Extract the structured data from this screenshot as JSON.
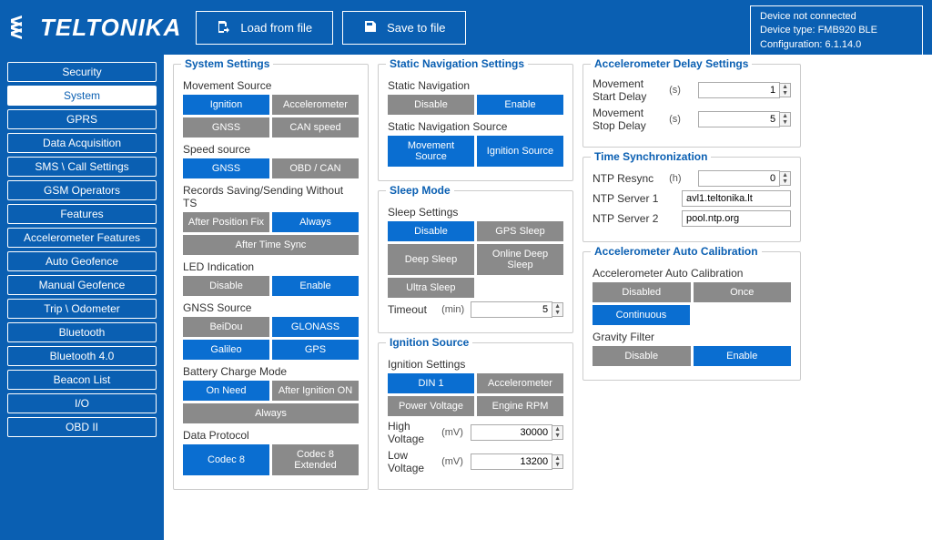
{
  "header": {
    "logo_text": "TELTONIKA",
    "load_label": "Load from file",
    "save_label": "Save to file",
    "device_line1": "Device not connected",
    "device_line2": "Device type: FMB920 BLE",
    "device_line3": "Configuration: 6.1.14.0"
  },
  "sidebar": {
    "items": [
      {
        "label": "Security",
        "active": false
      },
      {
        "label": "System",
        "active": true
      },
      {
        "label": "GPRS",
        "active": false
      },
      {
        "label": "Data Acquisition",
        "active": false
      },
      {
        "label": "SMS \\ Call Settings",
        "active": false
      },
      {
        "label": "GSM Operators",
        "active": false
      },
      {
        "label": "Features",
        "active": false
      },
      {
        "label": "Accelerometer Features",
        "active": false
      },
      {
        "label": "Auto Geofence",
        "active": false
      },
      {
        "label": "Manual Geofence",
        "active": false
      },
      {
        "label": "Trip \\ Odometer",
        "active": false
      },
      {
        "label": "Bluetooth",
        "active": false
      },
      {
        "label": "Bluetooth 4.0",
        "active": false
      },
      {
        "label": "Beacon List",
        "active": false
      },
      {
        "label": "I/O",
        "active": false
      },
      {
        "label": "OBD II",
        "active": false
      }
    ]
  },
  "system_settings": {
    "title": "System Settings",
    "movement_source_label": "Movement Source",
    "movement_source": {
      "ignition": "Ignition",
      "accelerometer": "Accelerometer",
      "gnss": "GNSS",
      "can_speed": "CAN speed"
    },
    "speed_source_label": "Speed source",
    "speed_source": {
      "gnss": "GNSS",
      "obd_can": "OBD / CAN"
    },
    "records_label": "Records Saving/Sending Without TS",
    "records": {
      "after_position": "After Position Fix",
      "always": "Always",
      "after_time": "After Time Sync"
    },
    "led_label": "LED Indication",
    "led": {
      "disable": "Disable",
      "enable": "Enable"
    },
    "gnss_source_label": "GNSS Source",
    "gnss_source": {
      "beidou": "BeiDou",
      "glonass": "GLONASS",
      "galileo": "Galileo",
      "gps": "GPS"
    },
    "battery_label": "Battery Charge Mode",
    "battery": {
      "on_need": "On Need",
      "after_ignition": "After Ignition ON",
      "always": "Always"
    },
    "data_protocol_label": "Data Protocol",
    "data_protocol": {
      "codec8": "Codec 8",
      "codec8ext": "Codec 8 Extended"
    }
  },
  "static_nav": {
    "title": "Static Navigation Settings",
    "nav_label": "Static Navigation",
    "nav": {
      "disable": "Disable",
      "enable": "Enable"
    },
    "source_label": "Static Navigation Source",
    "source": {
      "movement": "Movement Source",
      "ignition": "Ignition Source"
    }
  },
  "sleep": {
    "title": "Sleep Mode",
    "settings_label": "Sleep Settings",
    "opts": {
      "disable": "Disable",
      "gps": "GPS Sleep",
      "deep": "Deep Sleep",
      "online": "Online Deep Sleep",
      "ultra": "Ultra Sleep"
    },
    "timeout_label": "Timeout",
    "timeout_unit": "(min)",
    "timeout_value": "5"
  },
  "ignition": {
    "title": "Ignition Source",
    "settings_label": "Ignition Settings",
    "opts": {
      "din1": "DIN 1",
      "accel": "Accelerometer",
      "power": "Power Voltage",
      "rpm": "Engine RPM"
    },
    "high_label": "High Voltage",
    "high_unit": "(mV)",
    "high_value": "30000",
    "low_label": "Low Voltage",
    "low_unit": "(mV)",
    "low_value": "13200"
  },
  "accel_delay": {
    "title": "Accelerometer Delay Settings",
    "start_label": "Movement Start Delay",
    "start_unit": "(s)",
    "start_value": "1",
    "stop_label": "Movement Stop Delay",
    "stop_unit": "(s)",
    "stop_value": "5"
  },
  "time_sync": {
    "title": "Time Synchronization",
    "resync_label": "NTP Resync",
    "resync_unit": "(h)",
    "resync_value": "0",
    "server1_label": "NTP Server 1",
    "server1_value": "avl1.teltonika.lt",
    "server2_label": "NTP Server 2",
    "server2_value": "pool.ntp.org"
  },
  "accel_cal": {
    "title": "Accelerometer Auto Calibration",
    "cal_label": "Accelerometer Auto Calibration",
    "opts": {
      "disabled": "Disabled",
      "once": "Once",
      "continuous": "Continuous"
    },
    "gravity_label": "Gravity Filter",
    "gravity": {
      "disable": "Disable",
      "enable": "Enable"
    }
  }
}
